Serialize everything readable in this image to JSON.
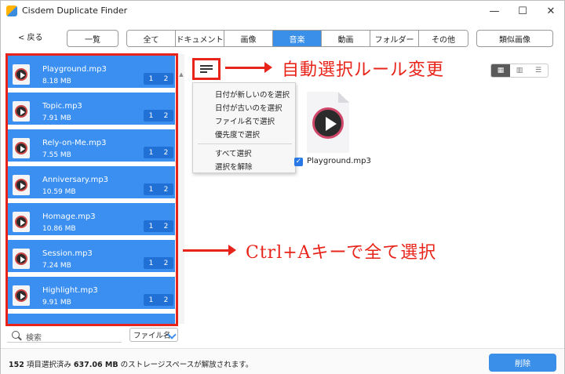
{
  "window": {
    "title": "Cisdem Duplicate Finder",
    "controls": [
      "—",
      "☐",
      "✕"
    ]
  },
  "toolbar": {
    "back_label": "< 戻る",
    "list_label": "一覧",
    "tabs": [
      "全て",
      "ドキュメント",
      "画像",
      "音楽",
      "動画",
      "フォルダー",
      "その他"
    ],
    "active_tab": "音楽",
    "similar_images_label": "類似画像"
  },
  "files": [
    {
      "name": "Playground.mp3",
      "size": "8.18 MB",
      "counts": [
        "1",
        "2"
      ]
    },
    {
      "name": "Topic.mp3",
      "size": "7.91 MB",
      "counts": [
        "1",
        "2"
      ]
    },
    {
      "name": "Rely-on-Me.mp3",
      "size": "7.55 MB",
      "counts": [
        "1",
        "2"
      ]
    },
    {
      "name": "Anniversary.mp3",
      "size": "10.59 MB",
      "counts": [
        "1",
        "2"
      ]
    },
    {
      "name": "Homage.mp3",
      "size": "10.86 MB",
      "counts": [
        "1",
        "2"
      ]
    },
    {
      "name": "Session.mp3",
      "size": "7.24 MB",
      "counts": [
        "1",
        "2"
      ]
    },
    {
      "name": "Highlight.mp3",
      "size": "9.91 MB",
      "counts": [
        "1",
        "2"
      ]
    }
  ],
  "search": {
    "placeholder": "検索"
  },
  "sort": {
    "selected": "ファイル名"
  },
  "auto_select_menu": {
    "items": [
      "日付が新しいのを選択",
      "日付が古いのを選択",
      "ファイル名で選択",
      "優先度で選択"
    ],
    "items2": [
      "すべて選択",
      "選択を解除"
    ]
  },
  "preview": {
    "file_name": "Playground.mp3",
    "checked": true
  },
  "view_modes": [
    "grid-icon",
    "filmstrip-icon",
    "list-icon"
  ],
  "annotations": {
    "auto_select": "自動選択ルール変更",
    "select_all": "Ctrl+Aキーで全て選択"
  },
  "status": {
    "count": "152",
    "count_suffix": "項目選択済み",
    "size": "637.06 MB",
    "size_suffix": "のストレージスペースが解放されます。"
  },
  "delete_label": "削除",
  "colors": {
    "accent": "#3a8fe8",
    "annotation": "#e8241a"
  }
}
